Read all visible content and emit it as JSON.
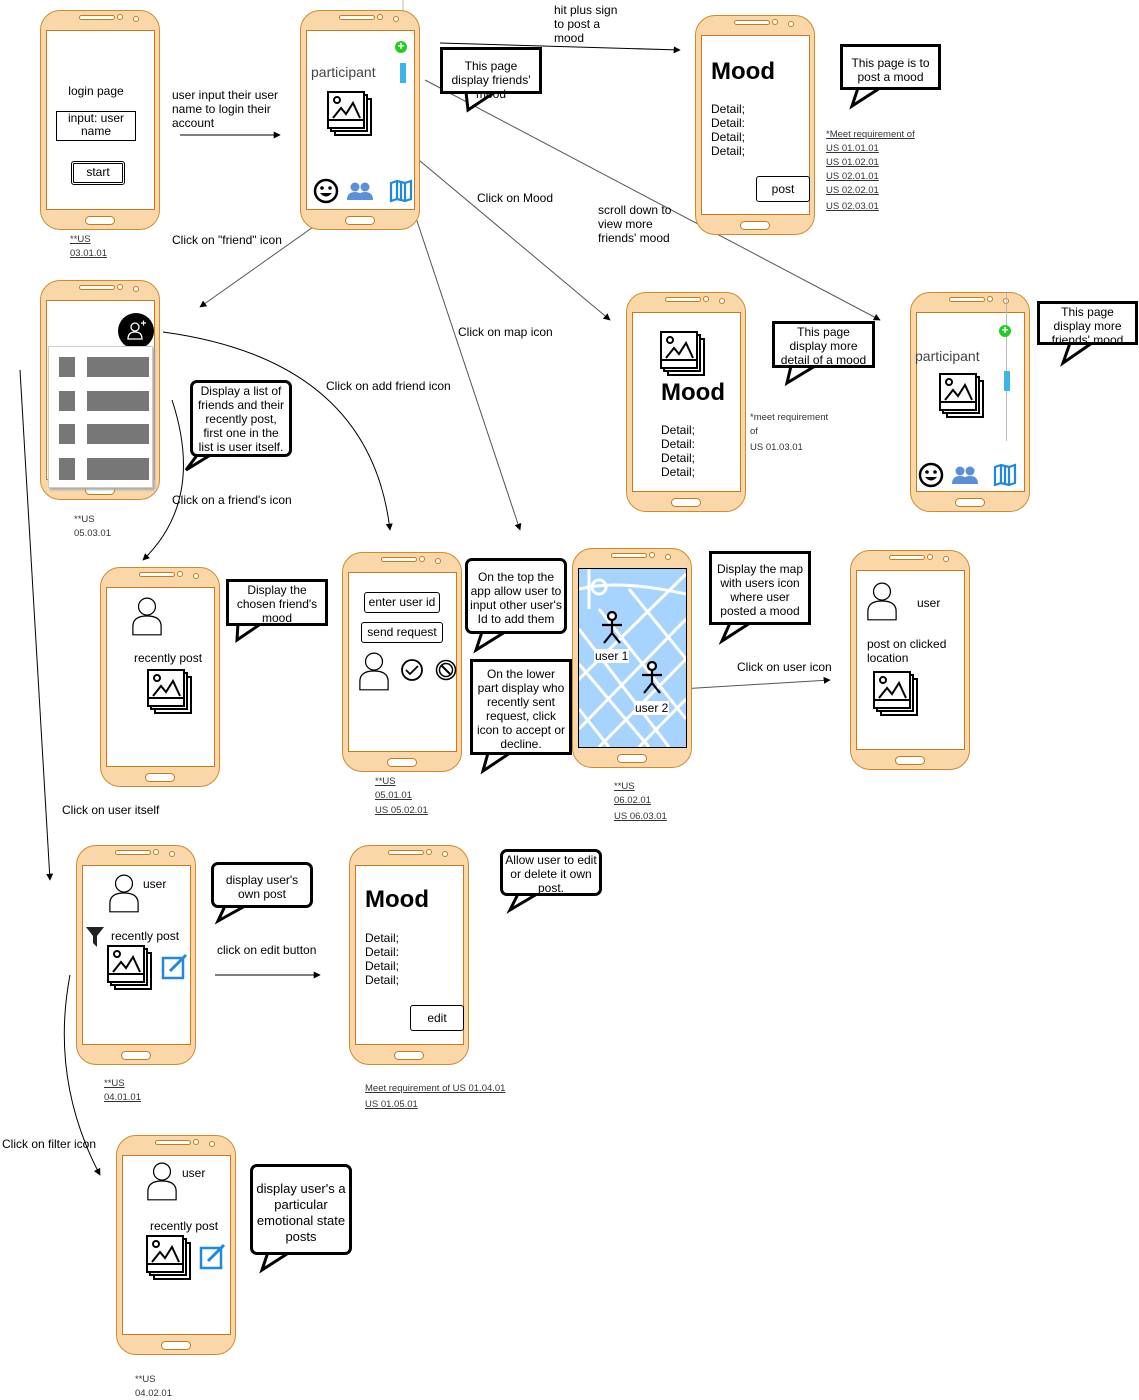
{
  "labels": {
    "login_arrow": "user input their user name to login their account",
    "plus": "hit plus sign to post a mood",
    "friend": "Click on \"friend\" icon",
    "mood": "Click on Mood",
    "scroll": "scroll down to view more friends' mood",
    "map": "Click on map icon",
    "add_friend": "Click on add friend icon",
    "friend_icon": "Click on a friend's icon",
    "user_icon": "Click on user icon",
    "user_itself": "Click on user itself",
    "edit": "click on edit button",
    "filter": "Click on filter icon"
  },
  "callouts": {
    "friends_mood": "This page display friends' mood",
    "post_mood": "This page is to post a mood",
    "detail": "This page display more detail of a mood",
    "more_friends": "This page display more friends' mood",
    "list": "Display a list of friends and their recently post, first one in the list is user itself.",
    "chosen": "Display the chosen friend's mood",
    "top": "On the top the app allow user to input other user's Id to add them",
    "lower": "On the lower part display who recently sent request, click icon to accept or decline.",
    "map": "Display the map with users icon where user posted a mood",
    "own": "display user's own post",
    "edit_delete": "Allow user to edit or delete it own post.",
    "emotional": "display user's a particular emotional state posts"
  },
  "requirements": {
    "login": [
      "**US",
      "03.01.01"
    ],
    "post": [
      "*Meet requirement of ",
      "US 01.01.01",
      "US 01.02.01",
      "US 02.01.01",
      "US 02.02.01",
      "US 02.03.01"
    ],
    "list": [
      "**US",
      "05.03.01"
    ],
    "detail": [
      "*meet requirement",
      "of",
      "US 01.03.01"
    ],
    "add": [
      "**US",
      "05.01.01",
      "US 05.02.01"
    ],
    "map": [
      "**US",
      "06.02.01",
      "US 06.03.01"
    ],
    "own": [
      "**US",
      "04.01.01"
    ],
    "edit": [
      "Meet requirement of US 01.04.01",
      "US 01.05.01"
    ],
    "filter": [
      "**US",
      "04.02.01"
    ]
  },
  "screens": {
    "login": {
      "title": "login page",
      "input": "input: user name",
      "button": "start"
    },
    "participant": {
      "title": "participant"
    },
    "post": {
      "title": "Mood",
      "details": [
        "Detail;",
        "Detail:",
        "Detail;",
        "Detail;"
      ],
      "button": "post"
    },
    "detail": {
      "title": "Mood",
      "details": [
        "Detail;",
        "Detail:",
        "Detail;",
        "Detail;"
      ]
    },
    "more": {
      "title": "participant"
    },
    "friend": {
      "caption": "recently post"
    },
    "add": {
      "input": "enter user id",
      "button": "send request"
    },
    "map": {
      "user1": "user 1",
      "user2": "user 2",
      "map_color": "#a6d4ff"
    },
    "location": {
      "user": "user",
      "caption": "post on clicked location"
    },
    "own": {
      "user": "user",
      "caption": "recently post"
    },
    "edit": {
      "title": "Mood",
      "details": [
        "Detail;",
        "Detail:",
        "Detail;",
        "Detail;"
      ],
      "button": "edit"
    },
    "filter": {
      "user": "user",
      "caption": "recently post"
    }
  },
  "colors": {
    "phone": "#fad7a8",
    "phone_border": "#d08a2e",
    "accent_blue": "#1e88e5",
    "plus_green": "#22cc22"
  }
}
